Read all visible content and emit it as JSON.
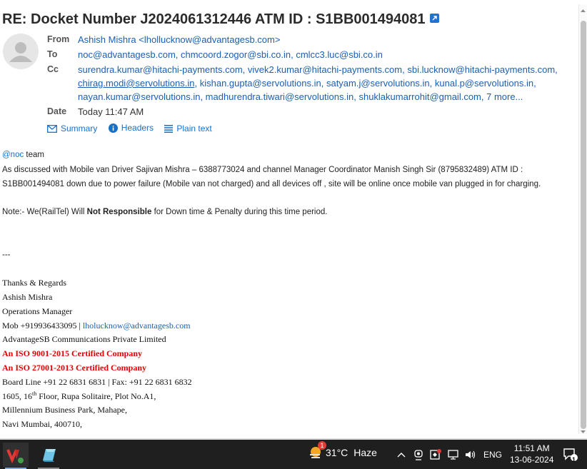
{
  "email": {
    "subject": "RE: Docket Number J2024061312446 ATM ID : S1BB001494081",
    "headers": {
      "from_label": "From",
      "from_value": "Ashish Mishra <lhollucknow@advantagesb.com>",
      "to_label": "To",
      "to_value": "noc@advantagesb.com, chmcoord.zogor@sbi.co.in, cmlcc3.luc@sbi.co.in",
      "cc_label": "Cc",
      "cc_lines": [
        "surendra.kumar@hitachi-payments.com, vivek2.kumar@hitachi-payments.com, sbi.lucknow@hitachi-payments.com,",
        "chirag.modi@servolutions.in",
        ", kishan.gupta@servolutions.in, satyam.j@servolutions.in, kunal.p@servolutions.in,",
        "nayan.kumar@servolutions.in, madhurendra.tiwari@servolutions.in, shuklakumarrohit@gmail.com, 7 more..."
      ],
      "date_label": "Date",
      "date_value": "Today 11:47 AM"
    },
    "views": {
      "summary": "Summary",
      "headers": "Headers",
      "plain": "Plain text"
    },
    "body": {
      "mention": "@noc",
      "greeting_rest": " team",
      "line1": "As discussed with Mobile van Driver Sajivan Mishra – 6388773024 and channel Manager Coordinator Manish Singh Sir (8795832489) ATM ID :",
      "line2": "S1BB001494081 down due to power failure (Mobile van not charged) and all devices off , site will be online once mobile van plugged in for charging.",
      "note_pre": "Note:- We(RailTel) Will ",
      "note_bold": "Not Responsible",
      "note_post": " for Down time & Penalty during this time period.",
      "separator": "---"
    },
    "signature": {
      "thanks": "Thanks & Regards",
      "name": "Ashish Mishra",
      "title": "Operations Manager",
      "mob_prefix": "Mob +919936433095 | ",
      "mob_email": "lholucknow@advantagesb.com",
      "company": "AdvantageSB Communications Private Limited",
      "iso1": "An ISO 9001-2015 Certified Company",
      "iso2": "An ISO 27001-2013 Certified Company",
      "phones": "Board Line +91 22 6831 6831 | Fax: +91 22 6831 6832",
      "addr1_a": "1605, 16",
      "addr1_sup": "th",
      "addr1_b": " Floor, Rupa Solitaire, Plot No.A1,",
      "addr2": "Millennium Business Park, Mahape,",
      "addr3": "Navi Mumbai, 400710,"
    }
  },
  "taskbar": {
    "weather_badge": "1",
    "weather_temp": "31°C",
    "weather_desc": "Haze",
    "language": "ENG",
    "time": "11:51 AM",
    "date": "13-06-2024",
    "notification_count": "1"
  },
  "colors": {
    "link": "#1a5fb4",
    "accent": "#1a6fc9",
    "signature_red": "#e00000",
    "taskbar": "#1f1f1f"
  }
}
